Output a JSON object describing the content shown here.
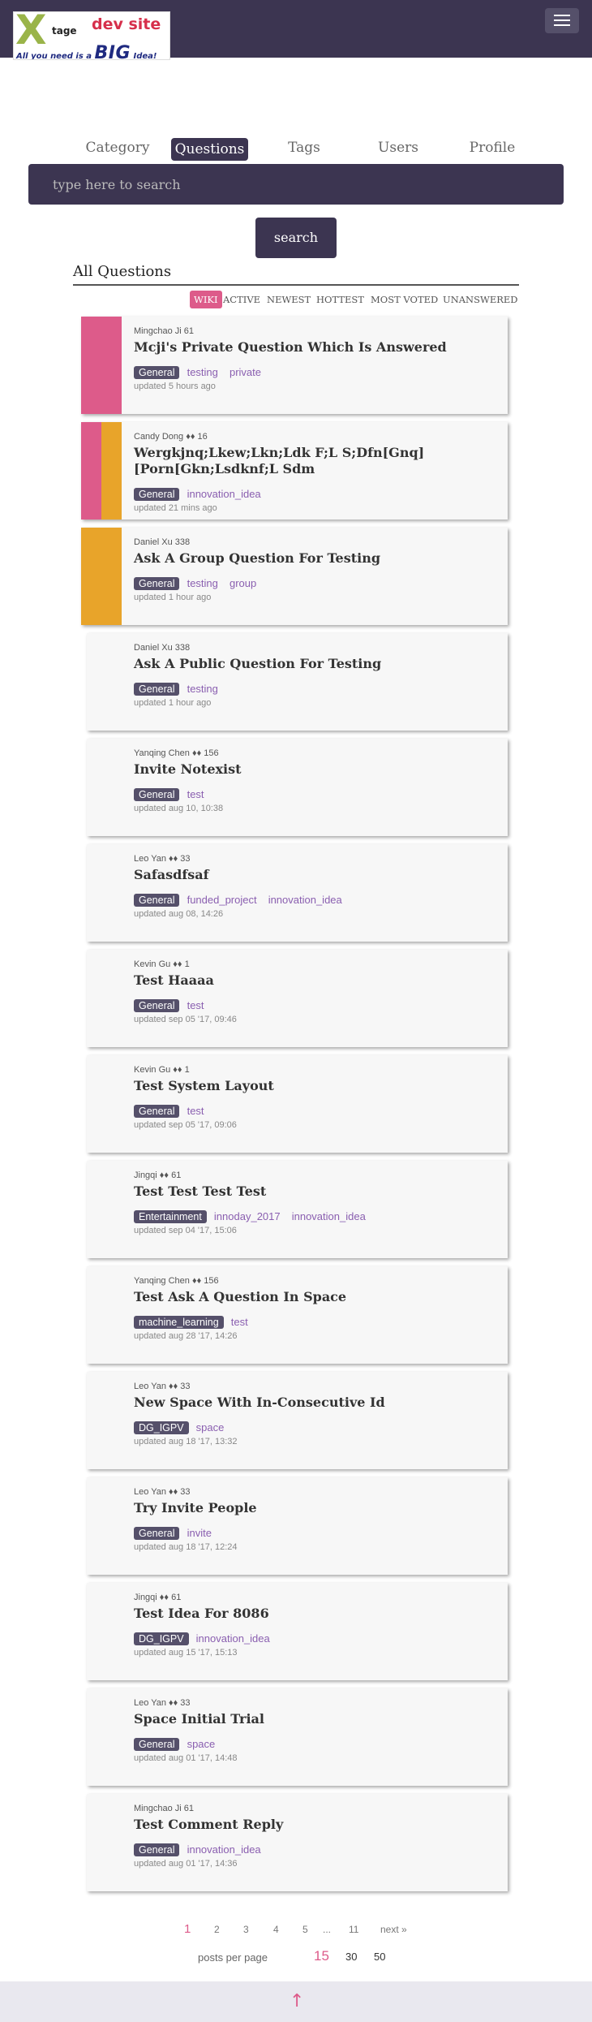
{
  "brand": {
    "x": "X",
    "tage": "tage",
    "devsite": "dev site",
    "tagline_pre": "All you need is a",
    "tagline_big": "BIG",
    "tagline_post": "Idea!"
  },
  "tabs": [
    {
      "label": "Category"
    },
    {
      "label": "Questions"
    },
    {
      "label": "Tags"
    },
    {
      "label": "Users"
    },
    {
      "label": "Profile"
    }
  ],
  "search": {
    "placeholder": "type here to search",
    "button": "search"
  },
  "section_title": "All Questions",
  "filters": [
    "WIKI",
    "ACTIVE",
    "NEWEST",
    "HOTTEST",
    "MOST VOTED",
    "UNANSWERED"
  ],
  "colors": {
    "pink": "#dd5b8a",
    "orange": "#e8a42a",
    "nav": "#3c3551"
  },
  "questions": [
    {
      "author": "Mingchao Ji 61",
      "title": "Mcji's Private Question Which Is Answered",
      "main_tag": "General",
      "tags": [
        "testing",
        "private"
      ],
      "updated": "updated 5 hours ago"
    },
    {
      "author": "Candy Dong ♦♦ 16",
      "title": "Wergkjnq;Lkew;Lkn;Ldk F;L S;Dfn[Gnq][Porn[Gkn;Lsdknf;L Sdm",
      "main_tag": "General",
      "tags": [
        "innovation_idea"
      ],
      "updated": "updated 21 mins ago"
    },
    {
      "author": "Daniel Xu 338",
      "title": "Ask A Group Question For Testing",
      "main_tag": "General",
      "tags": [
        "testing",
        "group"
      ],
      "updated": "updated 1 hour ago"
    },
    {
      "author": "Daniel Xu 338",
      "title": "Ask A Public Question For Testing",
      "main_tag": "General",
      "tags": [
        "testing"
      ],
      "updated": "updated 1 hour ago"
    },
    {
      "author": "Yanqing Chen ♦♦ 156",
      "title": "Invite Notexist",
      "main_tag": "General",
      "tags": [
        "test"
      ],
      "updated": "updated aug 10, 10:38"
    },
    {
      "author": "Leo Yan ♦♦ 33",
      "title": "Safasdfsaf",
      "main_tag": "General",
      "tags": [
        "funded_project",
        "innovation_idea"
      ],
      "updated": "updated aug 08, 14:26"
    },
    {
      "author": "Kevin Gu ♦♦ 1",
      "title": "Test Haaaa",
      "main_tag": "General",
      "tags": [
        "test"
      ],
      "updated": "updated sep 05 '17, 09:46"
    },
    {
      "author": "Kevin Gu ♦♦ 1",
      "title": "Test System Layout",
      "main_tag": "General",
      "tags": [
        "test"
      ],
      "updated": "updated sep 05 '17, 09:06"
    },
    {
      "author": "Jingqi ♦♦ 61",
      "title": "Test Test Test Test",
      "main_tag": "Entertainment",
      "tags": [
        "innoday_2017",
        "innovation_idea"
      ],
      "updated": "updated sep 04 '17, 15:06"
    },
    {
      "author": "Yanqing Chen ♦♦ 156",
      "title": "Test Ask A Question In Space",
      "main_tag": "machine_learning",
      "tags": [
        "test"
      ],
      "updated": "updated aug 28 '17, 14:26"
    },
    {
      "author": "Leo Yan ♦♦ 33",
      "title": "New Space With In-Consecutive Id",
      "main_tag": "DG_IGPV",
      "tags": [
        "space"
      ],
      "updated": "updated aug 18 '17, 13:32"
    },
    {
      "author": "Leo Yan ♦♦ 33",
      "title": "Try Invite People",
      "main_tag": "General",
      "tags": [
        "invite"
      ],
      "updated": "updated aug 18 '17, 12:24"
    },
    {
      "author": "Jingqi ♦♦ 61",
      "title": "Test Idea For 8086",
      "main_tag": "DG_IGPV",
      "tags": [
        "innovation_idea"
      ],
      "updated": "updated aug 15 '17, 15:13"
    },
    {
      "author": "Leo Yan ♦♦ 33",
      "title": "Space Initial Trial",
      "main_tag": "General",
      "tags": [
        "space"
      ],
      "updated": "updated aug 01 '17, 14:48"
    },
    {
      "author": "Mingchao Ji 61",
      "title": "Test Comment Reply",
      "main_tag": "General",
      "tags": [
        "innovation_idea"
      ],
      "updated": "updated aug 01 '17, 14:36"
    }
  ],
  "pagination": {
    "pages": [
      "1",
      "2",
      "3",
      "4",
      "5",
      "...",
      "11"
    ],
    "next": "next »",
    "current": "1"
  },
  "per_page": {
    "label": "posts per page",
    "options": [
      "15",
      "30",
      "50"
    ],
    "selected": "15"
  },
  "footer": {
    "icon": "arrow-up-icon",
    "glyph": "↑"
  }
}
